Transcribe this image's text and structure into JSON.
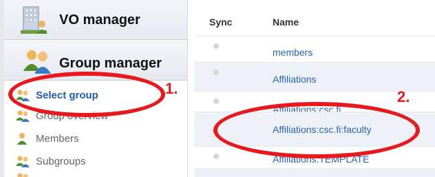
{
  "sidebar": {
    "vo_manager": {
      "title": "VO manager",
      "icon": "building-user-icon"
    },
    "group_manager": {
      "title": "Group manager",
      "icon": "group-users-icon"
    },
    "items": [
      {
        "label": "Select group",
        "icon": "group-users-icon",
        "selected": true
      },
      {
        "label": "Group overview",
        "icon": "group-users-icon"
      },
      {
        "label": "Members",
        "icon": "user-icon"
      },
      {
        "label": "Subgroups",
        "icon": "group-users-icon"
      }
    ]
  },
  "table": {
    "columns": {
      "sync": "Sync",
      "name": "Name"
    },
    "rows": [
      {
        "name": "members"
      },
      {
        "name": "Affiliations"
      },
      {
        "name": "Affiliations:csc.fi"
      },
      {
        "name": "Affiliations:csc.fi:faculty"
      },
      {
        "name": "Affiliations:TEMPLATE"
      }
    ]
  },
  "annotations": {
    "step1": "1.",
    "step2": "2."
  },
  "colors": {
    "annotation": "#e8191c",
    "link": "#2563b8",
    "selected": "#1f5cb5"
  }
}
